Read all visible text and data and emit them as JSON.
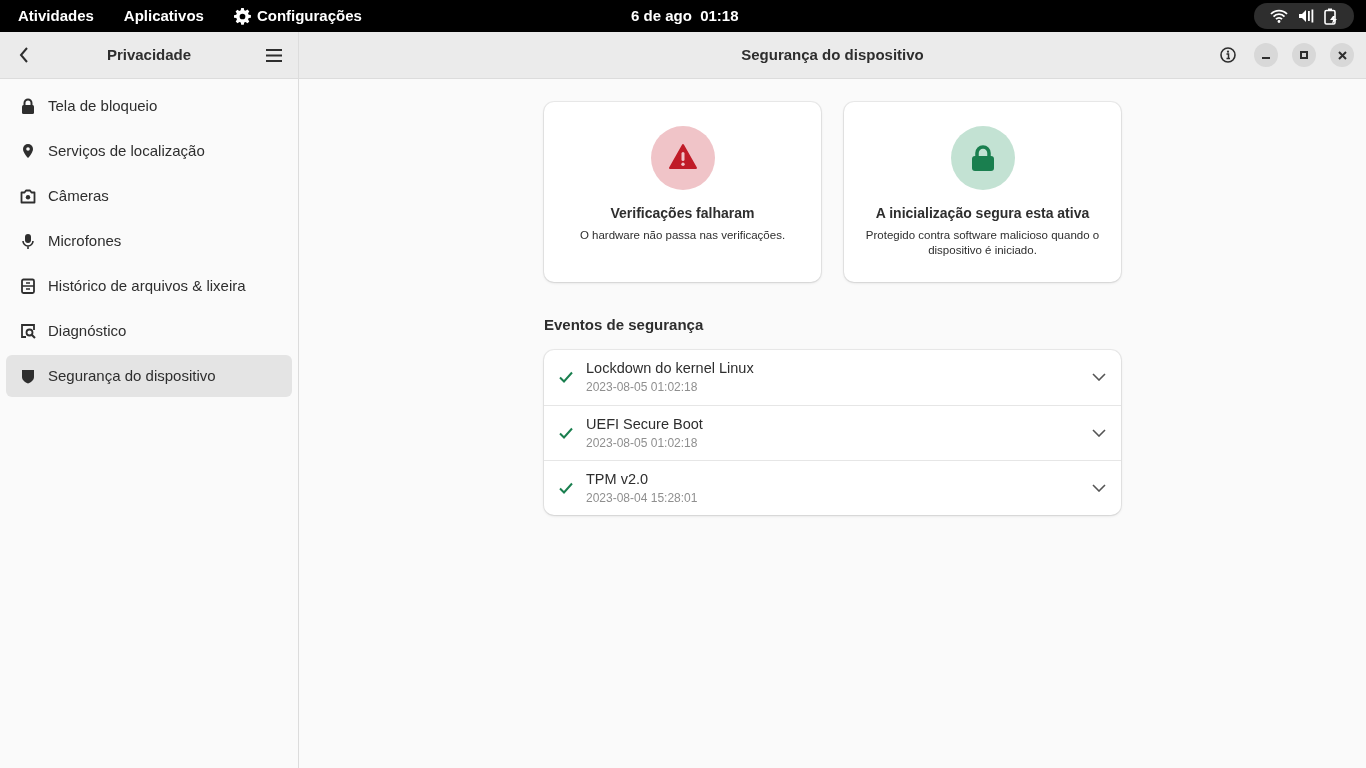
{
  "top_bar": {
    "activities": "Atividades",
    "applications": "Aplicativos",
    "app_menu": "Configurações",
    "clock": "6 de ago  01:18"
  },
  "sidebar": {
    "title": "Privacidade",
    "items": [
      {
        "label": "Tela de bloqueio",
        "selected": false
      },
      {
        "label": "Serviços de localização",
        "selected": false
      },
      {
        "label": "Câmeras",
        "selected": false
      },
      {
        "label": "Microfones",
        "selected": false
      },
      {
        "label": "Histórico de arquivos & lixeira",
        "selected": false
      },
      {
        "label": "Diagnóstico",
        "selected": false
      },
      {
        "label": "Segurança do dispositivo",
        "selected": true
      }
    ]
  },
  "window": {
    "title": "Segurança do dispositivo"
  },
  "status_cards": [
    {
      "kind": "fail",
      "title": "Verificações falharam",
      "description": "O hardware não passa nas verificações."
    },
    {
      "kind": "pass",
      "title": "A inicialização segura esta ativa",
      "description": "Protegido contra software malicioso quando o dispositivo é iniciado."
    }
  ],
  "events": {
    "heading": "Eventos de segurança",
    "rows": [
      {
        "name": "Lockdown do kernel Linux",
        "time": "2023-08-05 01:02:18",
        "passed": true,
        "expanded": false
      },
      {
        "name": "UEFI Secure Boot",
        "time": "2023-08-05 01:02:18",
        "passed": true,
        "expanded": false
      },
      {
        "name": "TPM v2.0",
        "time": "2023-08-04 15:28:01",
        "passed": true,
        "expanded": false
      }
    ]
  }
}
